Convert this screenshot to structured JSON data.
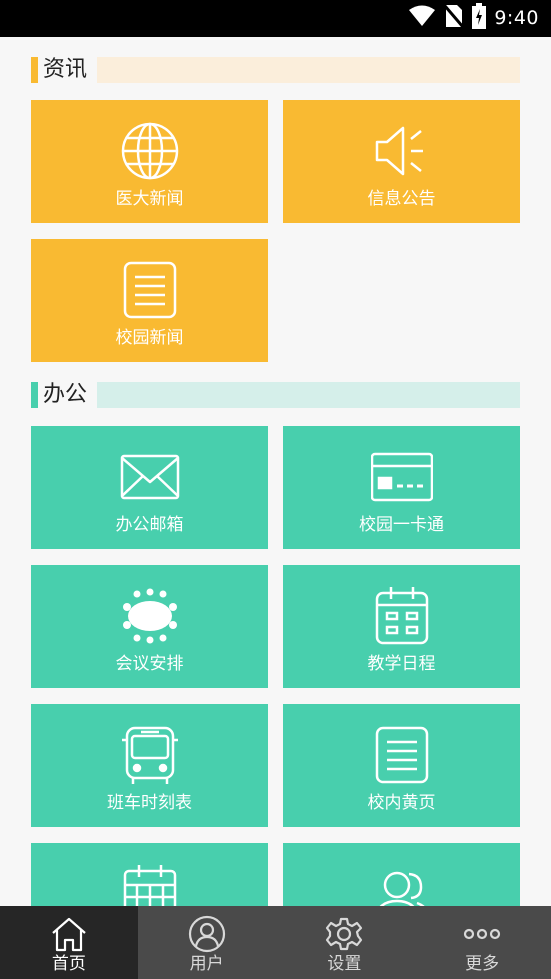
{
  "status_bar": {
    "time": "9:40"
  },
  "sections": [
    {
      "title": "资讯",
      "marker_color": "#f9ba32",
      "band_color": "#fbeedb"
    },
    {
      "title": "办公",
      "marker_color": "#48cfad",
      "band_color": "#d5efea"
    }
  ],
  "news_tiles": [
    {
      "label": "医大新闻",
      "icon": "globe-icon"
    },
    {
      "label": "信息公告",
      "icon": "speaker-icon"
    },
    {
      "label": "校园新闻",
      "icon": "list-document-icon"
    }
  ],
  "office_tiles": [
    {
      "label": "办公邮箱",
      "icon": "envelope-icon"
    },
    {
      "label": "校园一卡通",
      "icon": "card-icon"
    },
    {
      "label": "会议安排",
      "icon": "meeting-table-icon"
    },
    {
      "label": "教学日程",
      "icon": "calendar-icon"
    },
    {
      "label": "班车时刻表",
      "icon": "bus-icon"
    },
    {
      "label": "校内黄页",
      "icon": "list-document-icon"
    },
    {
      "label": "",
      "icon": "calendar-grid-icon"
    },
    {
      "label": "",
      "icon": "people-icon"
    }
  ],
  "bottom_nav": [
    {
      "label": "首页",
      "icon": "home-icon",
      "active": true
    },
    {
      "label": "用户",
      "icon": "user-icon",
      "active": false
    },
    {
      "label": "设置",
      "icon": "gear-icon",
      "active": false
    },
    {
      "label": "更多",
      "icon": "more-dots-icon",
      "active": false
    }
  ],
  "colors": {
    "yellow_tile": "#f9ba32",
    "green_tile": "#48cfad",
    "nav_background": "#4a4a4a",
    "nav_active": "#262626"
  }
}
